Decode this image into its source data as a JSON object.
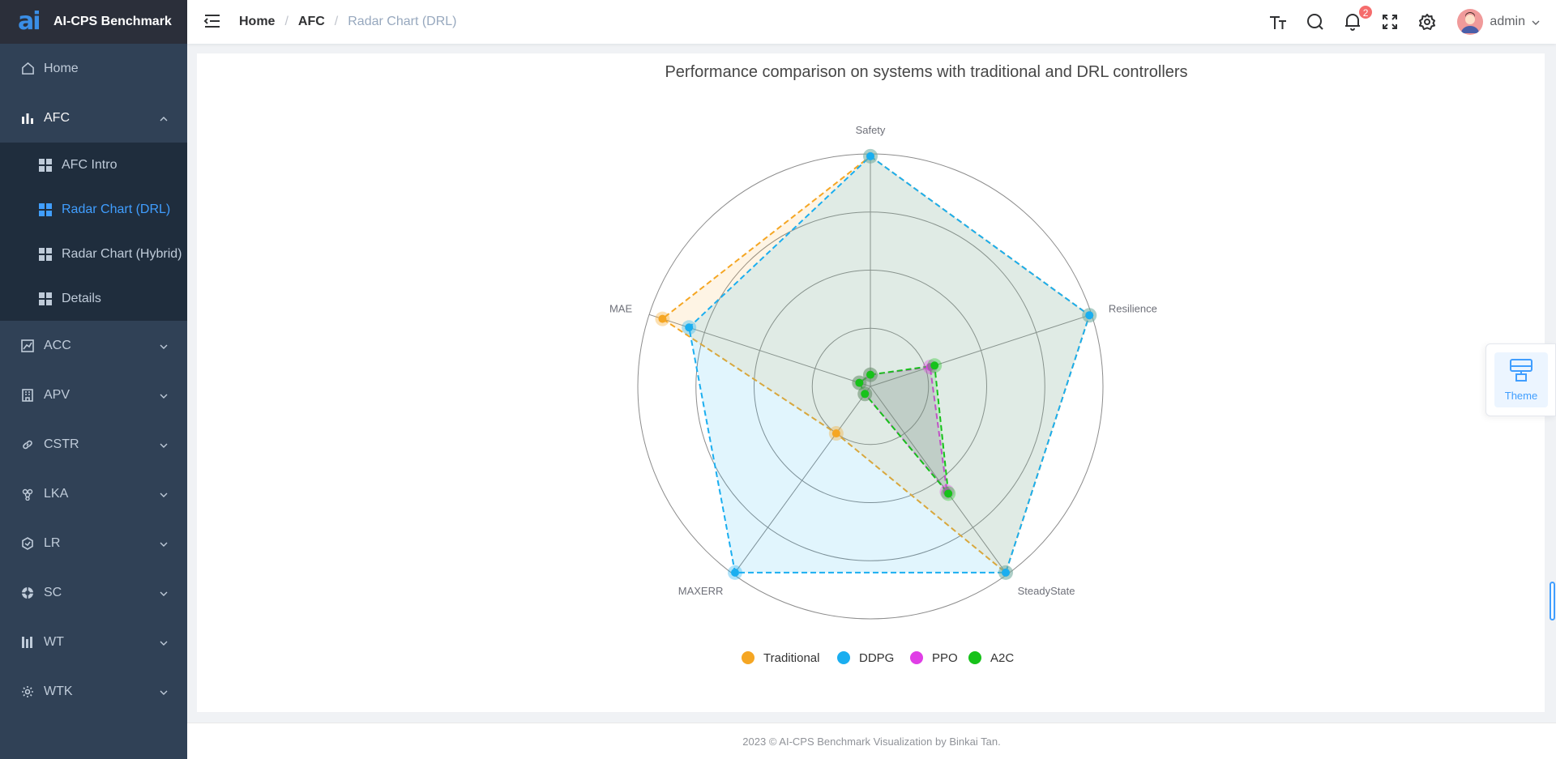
{
  "app": {
    "title": "AI-CPS Benchmark",
    "logo_glyph": "ai"
  },
  "sidebar": {
    "items": [
      {
        "label": "Home",
        "icon": "home-icon"
      },
      {
        "label": "AFC",
        "icon": "bar-chart-icon",
        "open": true,
        "children": [
          {
            "label": "AFC Intro",
            "icon": "grid-icon"
          },
          {
            "label": "Radar Chart (DRL)",
            "icon": "grid-icon",
            "active": true
          },
          {
            "label": "Radar Chart (Hybrid)",
            "icon": "grid-icon"
          },
          {
            "label": "Details",
            "icon": "grid-icon"
          }
        ]
      },
      {
        "label": "ACC",
        "icon": "line-chart-icon"
      },
      {
        "label": "APV",
        "icon": "building-icon"
      },
      {
        "label": "CSTR",
        "icon": "link-icon"
      },
      {
        "label": "LKA",
        "icon": "grape-icon"
      },
      {
        "label": "LR",
        "icon": "hexagon-icon"
      },
      {
        "label": "SC",
        "icon": "lifebuoy-icon"
      },
      {
        "label": "WT",
        "icon": "bars-icon"
      },
      {
        "label": "WTK",
        "icon": "gear-icon"
      }
    ]
  },
  "navbar": {
    "breadcrumb": [
      "Home",
      "AFC",
      "Radar Chart (DRL)"
    ],
    "separator": "/",
    "notification_count": "2",
    "user": "admin"
  },
  "theme_button": {
    "label": "Theme"
  },
  "footer": {
    "text": "2023 © AI-CPS Benchmark Visualization by Binkai Tan."
  },
  "colors": {
    "sidebar_bg": "#304156",
    "accent": "#409eff",
    "traditional": "#f5a623",
    "ddpg": "#1aaef0",
    "ppo": "#e03ee6",
    "a2c": "#17c21a"
  },
  "chart_data": {
    "type": "radar",
    "title": "Performance comparison on systems with traditional and DRL controllers",
    "indicators": [
      "Safety",
      "Resilience",
      "SteadyState",
      "MAXERR",
      "MAE"
    ],
    "max": 1,
    "rings": 4,
    "series": [
      {
        "name": "Traditional",
        "values": [
          0.99,
          0.99,
          0.99,
          0.25,
          0.94
        ]
      },
      {
        "name": "DDPG",
        "values": [
          0.99,
          0.99,
          0.99,
          0.99,
          0.82
        ]
      },
      {
        "name": "PPO",
        "values": [
          0.05,
          0.27,
          0.56,
          0.04,
          0.05
        ]
      },
      {
        "name": "A2C",
        "values": [
          0.05,
          0.29,
          0.57,
          0.04,
          0.05
        ]
      }
    ],
    "legend_position": "bottom"
  }
}
